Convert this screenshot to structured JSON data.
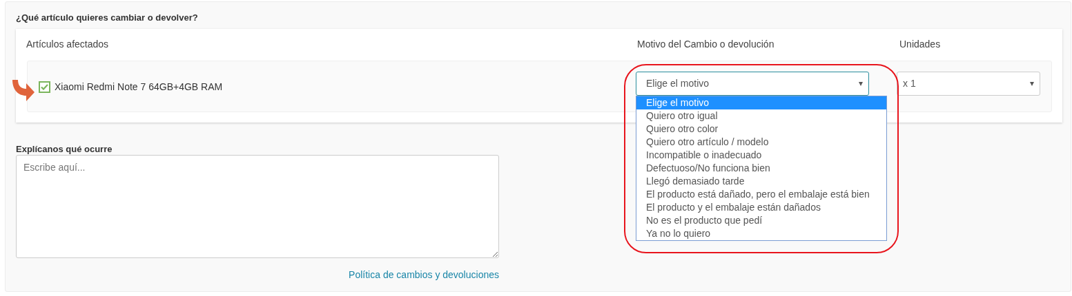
{
  "heading": "¿Qué artículo quieres cambiar o devolver?",
  "items_table": {
    "columns": [
      "Artículos afectados",
      "Motivo del Cambio o devolución",
      "Unidades"
    ],
    "rows": [
      {
        "product": "Xiaomi Redmi Note 7 64GB+4GB RAM",
        "checked": true,
        "reason_select": {
          "value": "Elige el motivo",
          "open": true,
          "options": [
            {
              "label": "Elige el motivo",
              "selected": true
            },
            {
              "label": "Quiero otro igual",
              "selected": false
            },
            {
              "label": "Quiero otro color",
              "selected": false
            },
            {
              "label": "Quiero otro artículo / modelo",
              "selected": false
            },
            {
              "label": "Incompatible o inadecuado",
              "selected": false
            },
            {
              "label": "Defectuoso/No funciona bien",
              "selected": false
            },
            {
              "label": "Llegó demasiado tarde",
              "selected": false
            },
            {
              "label": "El producto está dañado, pero el embalaje está bien",
              "selected": false
            },
            {
              "label": "El producto y el embalaje están dañados",
              "selected": false
            },
            {
              "label": "No es el producto que pedí",
              "selected": false
            },
            {
              "label": "Ya no lo quiero",
              "selected": false
            }
          ]
        },
        "units_select": {
          "value": "x 1"
        }
      }
    ]
  },
  "explanation": {
    "label": "Explícanos qué ocurre",
    "placeholder": "Escribe aquí..."
  },
  "policy_link": "Política de cambios y devoluciones"
}
